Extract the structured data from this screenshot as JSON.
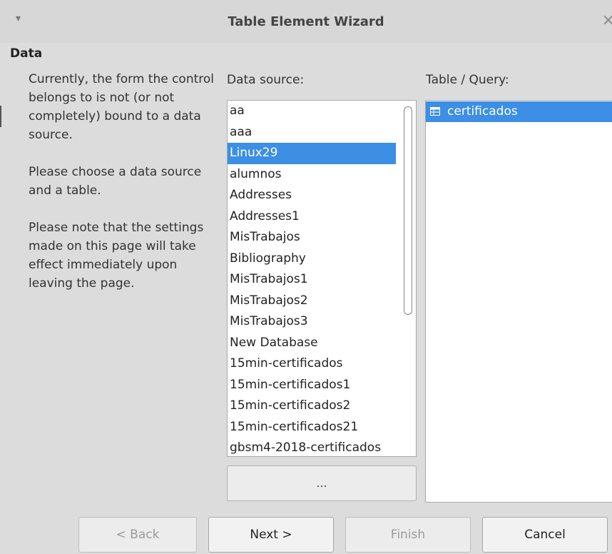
{
  "window": {
    "title": "Table Element Wizard",
    "menu_glyph": "▾",
    "close_glyph": "×"
  },
  "section": {
    "heading": "Data"
  },
  "description": {
    "p1": "Currently, the form the control belongs to is not (or not completely) bound to a data source.",
    "p2": "Please choose a data source and a table.",
    "p3": "Please note that the settings made on this page will take effect immediately upon leaving the page."
  },
  "data_source": {
    "label": "Data source:",
    "items": [
      "aa",
      "aaa",
      "Linux29",
      "alumnos",
      "Addresses",
      "Addresses1",
      "MisTrabajos",
      "Bibliography",
      "MisTrabajos1",
      "MisTrabajos2",
      "MisTrabajos3",
      "New Database",
      "15min-certificados",
      "15min-certificados1",
      "15min-certificados2",
      "15min-certificados21",
      "gbsm4-2018-certificados"
    ],
    "selected": "Linux29",
    "browse_label": "..."
  },
  "table_query": {
    "label": "Table / Query:",
    "items": [
      "certificados"
    ],
    "selected": "certificados",
    "icon": "table-icon"
  },
  "buttons": {
    "back": "< Back",
    "next": "Next >",
    "finish": "Finish",
    "cancel": "Cancel"
  },
  "colors": {
    "selection": "#3d8ee5",
    "background": "#dcdcdc"
  }
}
